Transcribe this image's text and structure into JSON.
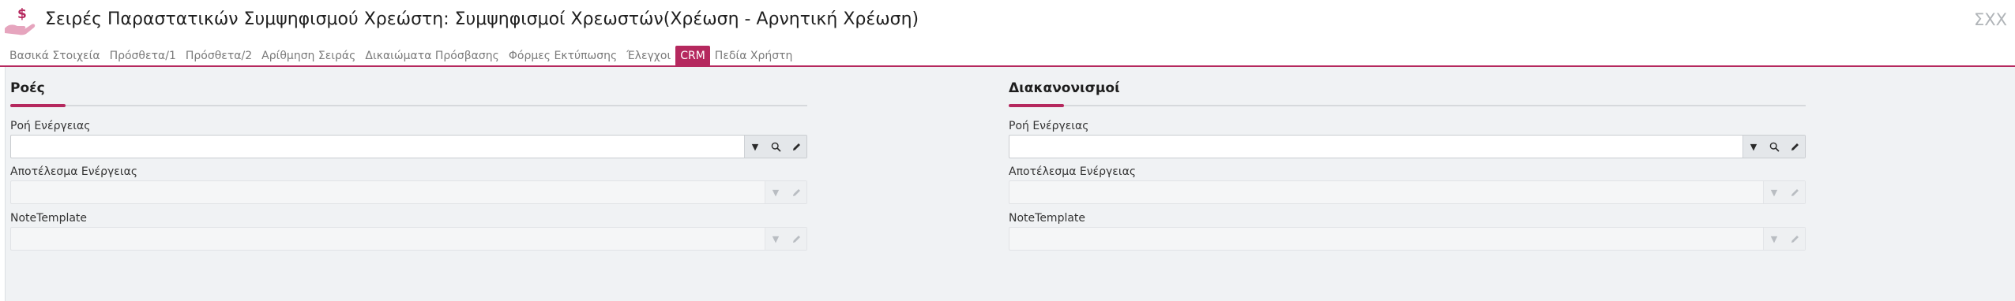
{
  "header": {
    "title": "Σειρές Παραστατικών Συμψηφισμού Χρεώστη: Συμψηφισμοί Χρεωστών(Χρέωση - Αρνητική Χρέωση)",
    "corner_code": "ΣΧΧ",
    "icon": "hand-holding-dollar-icon"
  },
  "tabs": [
    {
      "label": "Βασικά Στοιχεία"
    },
    {
      "label": "Πρόσθετα/1"
    },
    {
      "label": "Πρόσθετα/2"
    },
    {
      "label": "Αρίθμηση Σειράς"
    },
    {
      "label": "Δικαιώματα Πρόσβασης"
    },
    {
      "label": "Φόρμες Εκτύπωσης"
    },
    {
      "label": "Έλεγχοι"
    },
    {
      "label": "CRM",
      "active": true
    },
    {
      "label": "Πεδία Χρήστη"
    }
  ],
  "colors": {
    "accent": "#b5285e",
    "panel_bg": "#f0f2f4"
  },
  "sections": [
    {
      "title": "Ροές",
      "fields": [
        {
          "label": "Ροή Ενέργειας",
          "value": "",
          "enabled": true
        },
        {
          "label": "Αποτέλεσμα Ενέργειας",
          "value": "",
          "enabled": false
        },
        {
          "label": "NoteTemplate",
          "value": "",
          "enabled": false
        }
      ]
    },
    {
      "title": "Διακανονισμοί",
      "fields": [
        {
          "label": "Ροή Ενέργειας",
          "value": "",
          "enabled": true
        },
        {
          "label": "Αποτέλεσμα Ενέργειας",
          "value": "",
          "enabled": false
        },
        {
          "label": "NoteTemplate",
          "value": "",
          "enabled": false
        }
      ]
    }
  ],
  "field_buttons": {
    "dropdown": "▼",
    "search": "🔍",
    "edit": "✎"
  }
}
